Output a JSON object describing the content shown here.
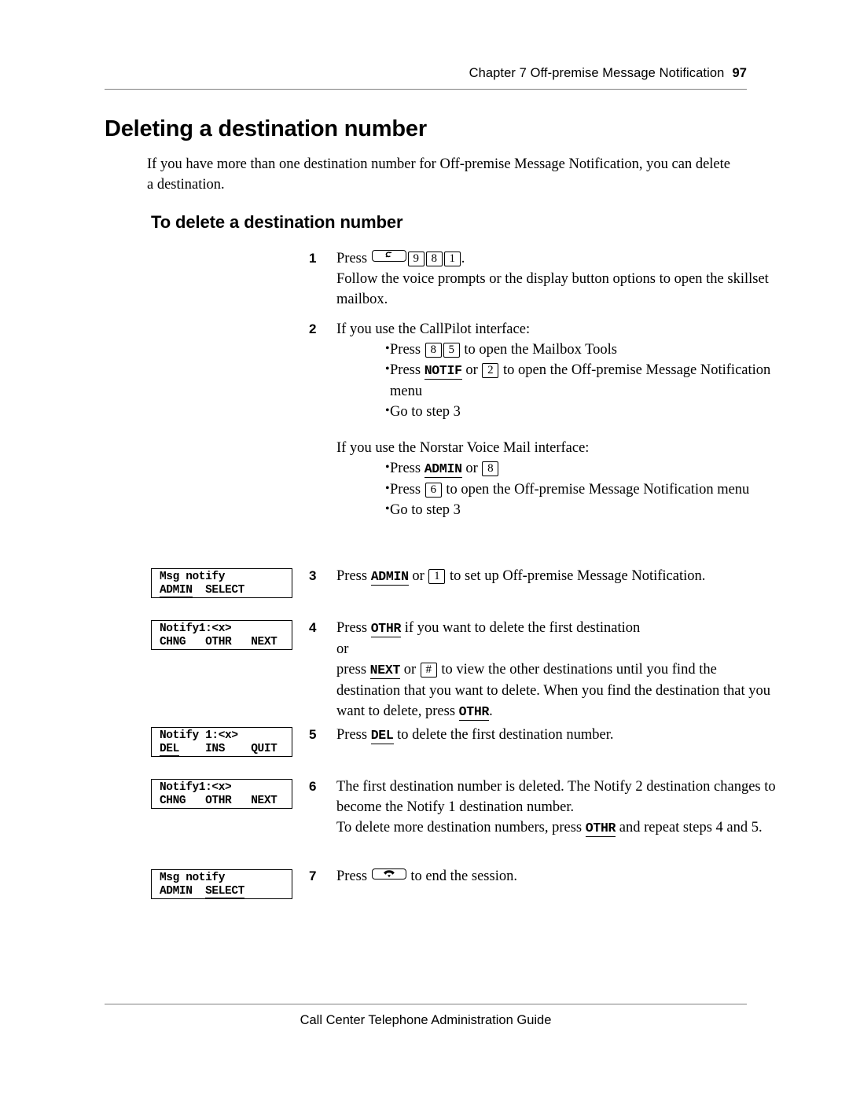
{
  "header": {
    "chapter": "Chapter 7  Off-premise Message Notification",
    "page_number": "97"
  },
  "footer": {
    "guide_title": "Call Center Telephone Administration Guide"
  },
  "headings": {
    "title": "Deleting a destination number",
    "subtitle": "To delete a destination number"
  },
  "intro": "If you have more than one destination number for Off-premise Message Notification, you can delete a destination.",
  "steps": {
    "step1": {
      "number": "1",
      "press_label": "Press",
      "keys": [
        "feature-key",
        "9",
        "8",
        "1"
      ],
      "period": ".",
      "line2": "Follow the voice prompts or the display button options to open the skillset mailbox."
    },
    "step2": {
      "number": "2",
      "intro_callpilot": "If you use the CallPilot interface:",
      "callpilot_bullets": [
        {
          "pre": "Press",
          "keys": [
            "8",
            "5"
          ],
          "post": "to open the Mailbox Tools"
        },
        {
          "pre": "Press",
          "softkey": "NOTIF",
          "or": "or",
          "keys": [
            "2"
          ],
          "post": "to open the Off-premise Message Notification menu"
        },
        {
          "pre": "Go to step 3"
        }
      ],
      "intro_norstar": "If you use the Norstar Voice Mail interface:",
      "norstar_bullets": [
        {
          "pre": "Press",
          "softkey": "ADMIN",
          "or": "or",
          "keys": [
            "8"
          ],
          "post": ""
        },
        {
          "pre": "Press",
          "keys": [
            "6"
          ],
          "post": "to open the Off-premise Message Notification menu"
        },
        {
          "pre": "Go to step 3"
        }
      ]
    },
    "step3": {
      "number": "3",
      "pre": "Press",
      "softkey": "ADMIN",
      "or": "or",
      "key": "1",
      "post": "to set up Off-premise Message Notification."
    },
    "step4": {
      "number": "4",
      "line1_pre": "Press",
      "line1_softkey": "OTHR",
      "line1_post": "if you want to delete the first destination",
      "line2": "or",
      "line3_pre": "press",
      "line3_softkey": "NEXT",
      "line3_or": "or",
      "line3_key": "#",
      "line3_post": "to view the other destinations until you find the destination that you want to delete. When you find the destination that you want to delete, press",
      "line3_softkey2": "OTHR",
      "line3_end": "."
    },
    "step5": {
      "number": "5",
      "pre": "Press",
      "softkey": "DEL",
      "post": "to delete the first destination number."
    },
    "step6": {
      "number": "6",
      "line1": "The first destination number is deleted. The Notify 2 destination changes to become the Notify 1 destination number.",
      "line2_pre": "To delete more destination numbers, press",
      "line2_softkey": "OTHR",
      "line2_post": "and repeat steps 4 and 5."
    },
    "step7": {
      "number": "7",
      "pre": "Press",
      "key": "release-key",
      "post": "to end the session."
    }
  },
  "displays": [
    {
      "name": "msg-notify-admin",
      "row1": "Msg notify",
      "row2_parts": [
        {
          "text": "ADMIN",
          "underline": true
        },
        {
          "text": "  ",
          "underline": false
        },
        {
          "text": "SELECT",
          "underline": false
        }
      ]
    },
    {
      "name": "notify1-chng",
      "row1": "Notify1:<x>",
      "row2_parts": [
        {
          "text": "CHNG",
          "underline": false
        },
        {
          "text": "   ",
          "underline": false
        },
        {
          "text": "OTHR",
          "underline": false
        },
        {
          "text": "   ",
          "underline": false
        },
        {
          "text": "NEXT",
          "underline": false
        }
      ]
    },
    {
      "name": "notify1-del",
      "row1": "Notify 1:<x>",
      "row2_parts": [
        {
          "text": "DEL",
          "underline": true
        },
        {
          "text": "    ",
          "underline": false
        },
        {
          "text": "INS",
          "underline": false
        },
        {
          "text": "    ",
          "underline": false
        },
        {
          "text": "QUIT",
          "underline": false
        }
      ]
    },
    {
      "name": "notify1-chng-after",
      "row1": "Notify1:<x>",
      "row2_parts": [
        {
          "text": "CHNG",
          "underline": false
        },
        {
          "text": "   ",
          "underline": false
        },
        {
          "text": "OTHR",
          "underline": false
        },
        {
          "text": "   ",
          "underline": false
        },
        {
          "text": "NEXT",
          "underline": false
        }
      ]
    },
    {
      "name": "msg-notify-select",
      "row1": "Msg notify",
      "row2_parts": [
        {
          "text": "ADMIN",
          "underline": false
        },
        {
          "text": "  ",
          "underline": false
        },
        {
          "text": "SELECT",
          "underline": true
        }
      ]
    }
  ],
  "colors": {
    "text": "#000000",
    "rule": "#808080",
    "background": "#ffffff"
  }
}
